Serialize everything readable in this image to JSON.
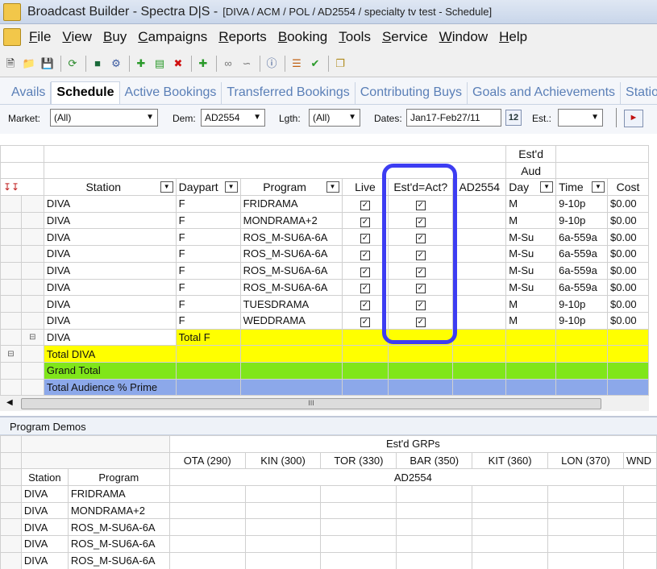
{
  "window": {
    "app_title": "Broadcast Builder - Spectra D|S -",
    "context": "[DIVA / ACM / POL / AD2554 / specialty tv test - Schedule]"
  },
  "menu": [
    "File",
    "View",
    "Buy",
    "Campaigns",
    "Reports",
    "Booking",
    "Tools",
    "Service",
    "Window",
    "Help"
  ],
  "tabs": [
    "Avails",
    "Schedule",
    "Active Bookings",
    "Transferred Bookings",
    "Contributing Buys",
    "Goals and Achievements",
    "Station"
  ],
  "active_tab": "Schedule",
  "filters": {
    "market_label": "Market:",
    "market_value": "(All)",
    "dem_label": "Dem:",
    "dem_value": "AD2554",
    "lgth_label": "Lgth:",
    "lgth_value": "(All)",
    "dates_label": "Dates:",
    "dates_value": "Jan17-Feb27/11",
    "est_label": "Est.:",
    "est_value": ""
  },
  "grid": {
    "top_header": {
      "estd": "Est'd",
      "aud": "Aud"
    },
    "columns": {
      "station": "Station",
      "daypart": "Daypart",
      "program": "Program",
      "live": "Live",
      "estd_act": "Est'd=Act?",
      "aud_col": "AD2554",
      "day": "Day",
      "time": "Time",
      "cost": "Cost"
    },
    "rows": [
      {
        "station": "DIVA",
        "daypart": "F",
        "program": "FRIDRAMA",
        "day": "M",
        "time": "9-10p",
        "cost": "$0.00"
      },
      {
        "station": "DIVA",
        "daypart": "F",
        "program": "MONDRAMA+2",
        "day": "M",
        "time": "9-10p",
        "cost": "$0.00"
      },
      {
        "station": "DIVA",
        "daypart": "F",
        "program": "ROS_M-SU6A-6A",
        "day": "M-Su",
        "time": "6a-559a",
        "cost": "$0.00"
      },
      {
        "station": "DIVA",
        "daypart": "F",
        "program": "ROS_M-SU6A-6A",
        "day": "M-Su",
        "time": "6a-559a",
        "cost": "$0.00"
      },
      {
        "station": "DIVA",
        "daypart": "F",
        "program": "ROS_M-SU6A-6A",
        "day": "M-Su",
        "time": "6a-559a",
        "cost": "$0.00"
      },
      {
        "station": "DIVA",
        "daypart": "F",
        "program": "ROS_M-SU6A-6A",
        "day": "M-Su",
        "time": "6a-559a",
        "cost": "$0.00"
      },
      {
        "station": "DIVA",
        "daypart": "F",
        "program": "TUESDRAMA",
        "day": "M",
        "time": "9-10p",
        "cost": "$0.00"
      },
      {
        "station": "DIVA",
        "daypart": "F",
        "program": "WEDDRAMA",
        "day": "M",
        "time": "9-10p",
        "cost": "$0.00"
      }
    ],
    "totals": {
      "subtotal_station": "DIVA",
      "subtotal_daypart": "Total F",
      "total_diva": "Total DIVA",
      "grand_total": "Grand Total",
      "audience_prime": "Total Audience % Prime"
    }
  },
  "scroll_grip": "III",
  "program_demos": {
    "title": "Program Demos",
    "group_header": "Est'd  GRPs",
    "markets": [
      "OTA (290)",
      "KIN (300)",
      "TOR (330)",
      "BAR (350)",
      "KIT (360)",
      "LON (370)",
      "WND"
    ],
    "demo": "AD2554",
    "col_station": "Station",
    "col_program": "Program",
    "rows": [
      {
        "station": "DIVA",
        "program": "FRIDRAMA"
      },
      {
        "station": "DIVA",
        "program": "MONDRAMA+2"
      },
      {
        "station": "DIVA",
        "program": "ROS_M-SU6A-6A"
      },
      {
        "station": "DIVA",
        "program": "ROS_M-SU6A-6A"
      },
      {
        "station": "DIVA",
        "program": "ROS_M-SU6A-6A"
      }
    ]
  },
  "colors": {
    "highlight": "#3d3df2",
    "total_yellow": "#ffff00",
    "grand_green": "#80e61a",
    "prime_blue": "#8ca8ea"
  }
}
